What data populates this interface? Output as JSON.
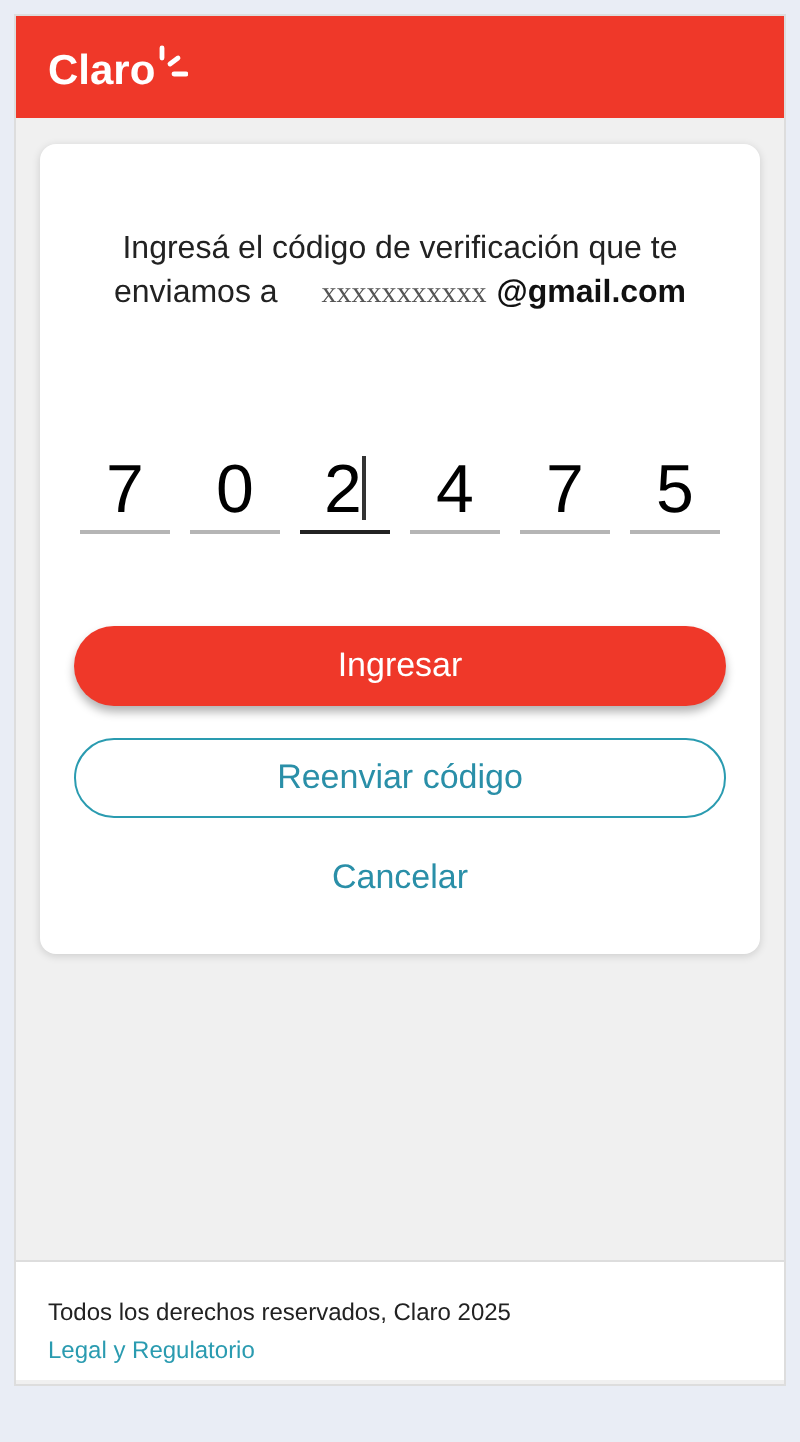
{
  "header": {
    "logo": "Claro"
  },
  "prompt": {
    "lines": [
      "Ingresá el código de verificación que te",
      "enviamos a"
    ],
    "masked_email": "xxxxxxxxxxx",
    "email_domain": "@gmail.com"
  },
  "code_digits": [
    {
      "value": "7",
      "selected": false
    },
    {
      "value": "0",
      "selected": false
    },
    {
      "value": "2",
      "selected": true
    },
    {
      "value": "4",
      "selected": false
    },
    {
      "value": "7",
      "selected": false
    },
    {
      "value": "5",
      "selected": false
    }
  ],
  "buttons": {
    "submit": "Ingresar",
    "resend": "Reenviar código",
    "cancel": "Cancelar"
  },
  "footer": {
    "copyright": "Todos los derechos reservados, Claro 2025",
    "link": "Legal y Regulatorio"
  }
}
